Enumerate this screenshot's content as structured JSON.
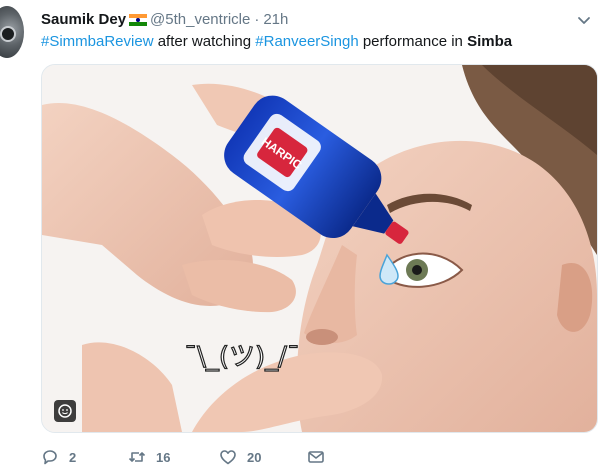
{
  "tweet": {
    "display_name": "Saumik Dey",
    "handle": "@5th_ventricle",
    "separator": "·",
    "time": "21h",
    "text_parts": {
      "hashtag1": "#SimmbaReview",
      "plain1": " after watching ",
      "hashtag2": "#RanveerSingh",
      "plain2": " performance in ",
      "bold": "Simba"
    },
    "media": {
      "bottle_brand": "HARPIC",
      "shrug_text": "¯\\_(ツ)_/¯"
    },
    "actions": {
      "reply_count": "2",
      "retweet_count": "16",
      "like_count": "20"
    },
    "icons": {
      "caret": "chevron-down-icon",
      "flag": "india-flag-icon",
      "reply": "reply-icon",
      "retweet": "retweet-icon",
      "like": "heart-icon",
      "dm": "envelope-icon",
      "gif": "gif-badge-icon"
    },
    "colors": {
      "hashtag": "#1b95e0",
      "muted": "#657786",
      "text": "#14171a"
    }
  }
}
